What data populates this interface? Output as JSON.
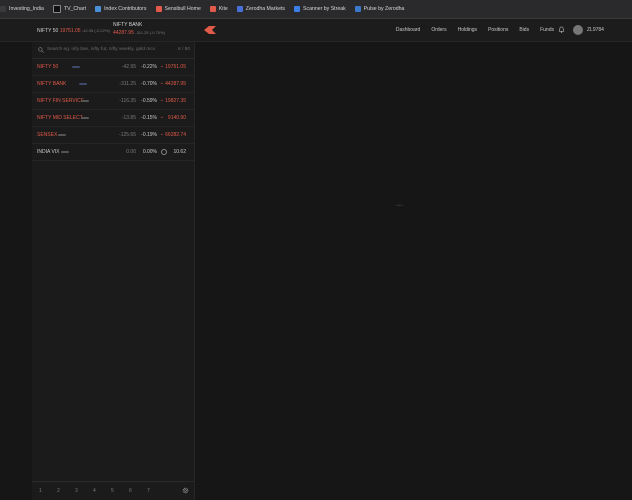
{
  "bookmarks": [
    {
      "label": "Investing_India",
      "color": "#3a3a3a"
    },
    {
      "label": "TV_Chart",
      "color": "#222"
    },
    {
      "label": "Index Contributors",
      "color": "#4a90d9"
    },
    {
      "label": "Sensibull Home",
      "color": "#e25a49"
    },
    {
      "label": "Kite",
      "color": "#e25a49"
    },
    {
      "label": "Zerodha Markets",
      "color": "#4a6fd9"
    },
    {
      "label": "Scanner by Streak",
      "color": "#3b7ee8"
    },
    {
      "label": "Pulse by Zerodha",
      "color": "#3a78c9"
    }
  ],
  "header": {
    "nifty50": {
      "name": "NIFTY 50",
      "value": "19751.05",
      "change": "-42.95 (-0.22%)"
    },
    "niftybank": {
      "name": "NIFTY BANK",
      "value": "44287.95",
      "change": "-311.25 (-0.70%)"
    },
    "nav": [
      "Dashboard",
      "Orders",
      "Holdings",
      "Positions",
      "Bids",
      "Funds"
    ],
    "user_id": "ZL9784"
  },
  "search": {
    "placeholder": "Search eg: infy bse, nifty fut, nifty weekly, gold mcx",
    "count": "6 / 50"
  },
  "watchlist": [
    {
      "name": "NIFTY 50",
      "change": "-42.95",
      "pct": "-0.22%",
      "ltp": "19751.05",
      "direction": "down"
    },
    {
      "name": "NIFTY BANK",
      "change": "-311.25",
      "pct": "-0.70%",
      "ltp": "44287.95",
      "direction": "down"
    },
    {
      "name": "NIFTY FIN SERVICE",
      "change": "-116.35",
      "pct": "-0.59%",
      "ltp": "19827.35",
      "direction": "down"
    },
    {
      "name": "NIFTY MID SELECT",
      "change": "-13.85",
      "pct": "-0.15%",
      "ltp": "9140.90",
      "direction": "down"
    },
    {
      "name": "SENSEX",
      "change": "-125.65",
      "pct": "-0.19%",
      "ltp": "66282.74",
      "direction": "down"
    },
    {
      "name": "INDIA VIX",
      "change": "0.00",
      "pct": "0.00%",
      "ltp": "10.62",
      "direction": "flat"
    }
  ],
  "pages": [
    "1",
    "2",
    "3",
    "4",
    "5",
    "6",
    "7"
  ],
  "colors": {
    "accent": "#e25a49",
    "background": "#161616"
  }
}
